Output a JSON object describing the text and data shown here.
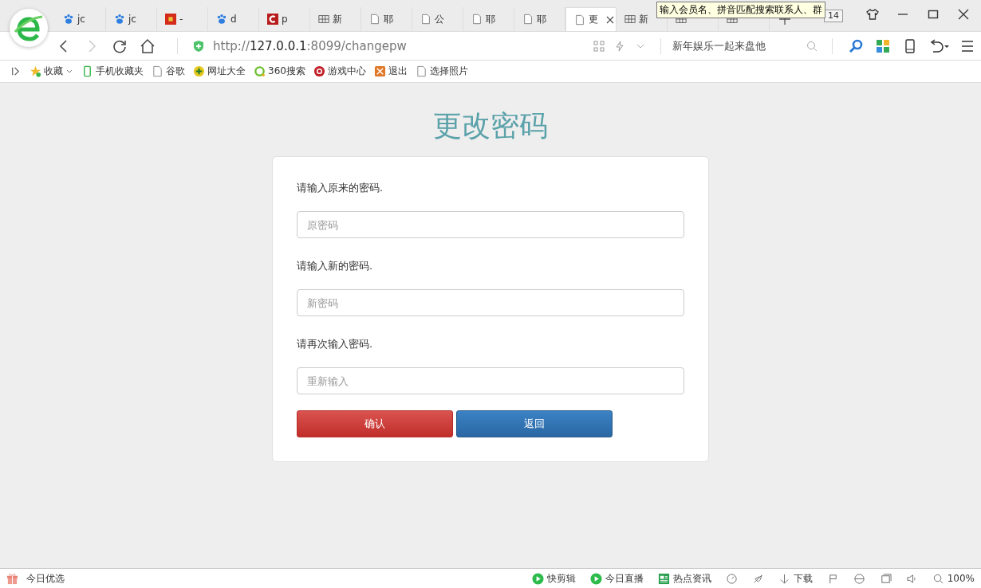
{
  "tabs": [
    {
      "label": "jc",
      "kind": "paw",
      "selected": false
    },
    {
      "label": "jc",
      "kind": "paw",
      "selected": false
    },
    {
      "label": "-",
      "kind": "flag",
      "selected": false
    },
    {
      "label": "d",
      "kind": "paw",
      "selected": false
    },
    {
      "label": "p",
      "kind": "c-logo",
      "selected": false
    },
    {
      "label": "新",
      "kind": "grid",
      "selected": false
    },
    {
      "label": "耶",
      "kind": "page",
      "selected": false
    },
    {
      "label": "公",
      "kind": "page",
      "selected": false
    },
    {
      "label": "耶",
      "kind": "page",
      "selected": false
    },
    {
      "label": "耶",
      "kind": "page",
      "selected": false
    },
    {
      "label": "更",
      "kind": "page",
      "selected": true
    },
    {
      "label": "新",
      "kind": "grid",
      "selected": false
    },
    {
      "kind": "grid",
      "selected": false
    },
    {
      "kind": "grid",
      "selected": false
    }
  ],
  "tab_count": "14",
  "tooltip": "输入会员名、拼音匹配搜索联系人、群",
  "address": {
    "scheme": "http://",
    "host": "127.0.0.1",
    "rest": ":8099/changepw"
  },
  "search": {
    "placeholder": "新年娱乐一起来盘他"
  },
  "bookmarks": [
    {
      "label": "收藏",
      "kind": "star"
    },
    {
      "label": "手机收藏夹",
      "kind": "phone"
    },
    {
      "label": "谷歌",
      "kind": "page"
    },
    {
      "label": "网址大全",
      "kind": "plus-circle"
    },
    {
      "label": "360搜索",
      "kind": "ring"
    },
    {
      "label": "游戏中心",
      "kind": "game"
    },
    {
      "label": "退出",
      "kind": "box"
    },
    {
      "label": "选择照片",
      "kind": "page"
    }
  ],
  "page": {
    "title": "更改密码",
    "fields": [
      {
        "label": "请输入原来的密码.",
        "placeholder": "原密码"
      },
      {
        "label": "请输入新的密码.",
        "placeholder": "新密码"
      },
      {
        "label": "请再次输入密码.",
        "placeholder": "重新输入"
      }
    ],
    "buttons": [
      {
        "label": "确认",
        "kind": "danger"
      },
      {
        "label": "返回",
        "kind": "primary"
      }
    ]
  },
  "status_bar": {
    "left": "今日优选",
    "items": [
      {
        "label": "快剪辑",
        "kind": "play"
      },
      {
        "label": "今日直播",
        "kind": "play"
      },
      {
        "label": "热点资讯",
        "kind": "news"
      }
    ],
    "download": "下载",
    "zoom": "100%"
  }
}
